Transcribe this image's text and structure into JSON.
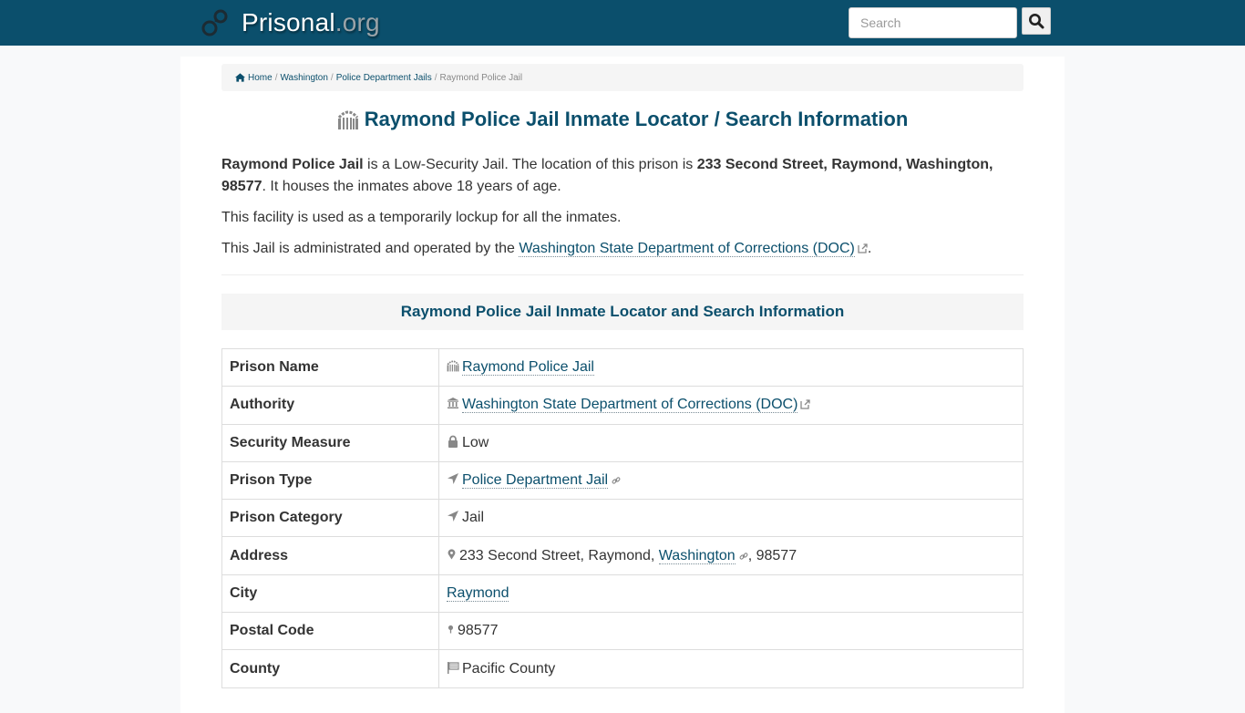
{
  "header": {
    "brand_name": "Prisonal",
    "brand_tld": ".org",
    "search_placeholder": "Search",
    "search_value": ""
  },
  "breadcrumb": {
    "items": [
      {
        "label": "Home",
        "link": true
      },
      {
        "label": "Washington",
        "link": true
      },
      {
        "label": "Police Department Jails",
        "link": true
      },
      {
        "label": "Raymond Police Jail",
        "link": false
      }
    ],
    "separator": "/"
  },
  "page": {
    "title": "Raymond Police Jail Inmate Locator / Search Information",
    "intro": {
      "p1_name": "Raymond Police Jail",
      "p1_text1": " is a Low-Security Jail. The location of this prison is ",
      "p1_address": "233 Second Street, Raymond, Washington, 98577",
      "p1_text2": ". It houses the inmates above 18 years of age.",
      "p2": "This facility is used as a temporarily lockup for all the inmates.",
      "p3_text": "This Jail is administrated and operated by the ",
      "p3_link": "Washington State Department of Corrections (DOC)",
      "p3_end": "."
    },
    "section_title": "Raymond Police Jail Inmate Locator and Search Information"
  },
  "table": {
    "rows": [
      {
        "label": "Prison Name",
        "value": "Raymond Police Jail",
        "icon": "prison-icon"
      },
      {
        "label": "Authority",
        "value": "Washington State Department of Corrections (DOC)",
        "icon": "bank-icon"
      },
      {
        "label": "Security Measure",
        "value": "Low",
        "icon": "lock-icon"
      },
      {
        "label": "Prison Type",
        "value": "Police Department Jail",
        "icon": "location-arrow-icon"
      },
      {
        "label": "Prison Category",
        "value": "Jail",
        "icon": "location-arrow-icon"
      },
      {
        "label": "Address",
        "value_street": "233 Second Street, Raymond, ",
        "value_state": "Washington",
        "value_zip": ", 98577",
        "icon": "map-marker-icon"
      },
      {
        "label": "City",
        "value": "Raymond"
      },
      {
        "label": "Postal Code",
        "value": "98577",
        "icon": "map-pin-icon"
      },
      {
        "label": "County",
        "value": "Pacific County",
        "icon": "flag-icon"
      }
    ]
  },
  "colors": {
    "brand": "#0b4f6c",
    "icon_gray": "#888888"
  }
}
